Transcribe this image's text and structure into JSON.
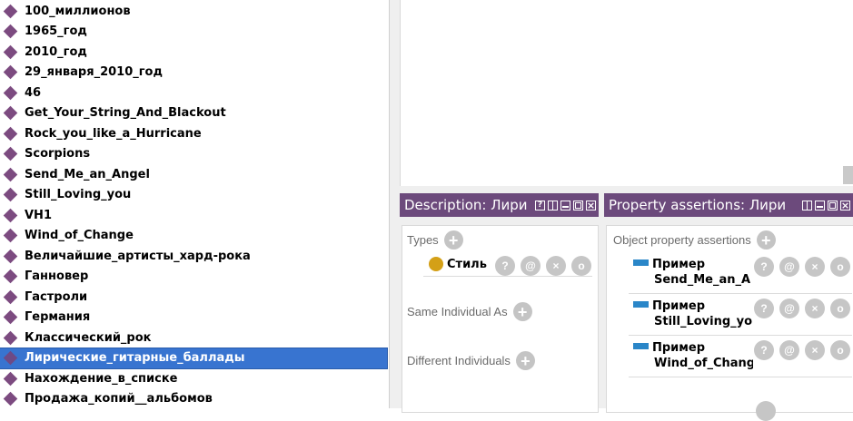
{
  "individuals": [
    "100_миллионов",
    "1965_год",
    "2010_год",
    "29_января_2010_год",
    "46",
    "Get_Your_String_And_Blackout",
    "Rock_you_like_a_Hurricane",
    "Scorpions",
    "Send_Me_an_Angel",
    "Still_Loving_you",
    "VH1",
    "Wind_of_Change",
    "Величайшие_артисты_хард-рока",
    "Ганновер",
    "Гастроли",
    "Германия",
    "Классический_рок",
    "Лирические_гитарные_баллады",
    "Нахождение_в_списке",
    "Продажа_копий__альбомов"
  ],
  "selected_individual": "Лирические_гитарные_баллады",
  "description_view": {
    "title": "Description: Лири",
    "types_label": "Types",
    "type_entry": "Стиль",
    "same_individual_label": "Same Individual As",
    "different_individuals_label": "Different Individuals"
  },
  "property_view": {
    "title": "Property assertions: Лири",
    "object_property_label": "Object property assertions",
    "assertions": [
      {
        "property": "Пример",
        "value": "Send_Me_an_A"
      },
      {
        "property": "Пример",
        "value": "Still_Loving_you"
      },
      {
        "property": "Пример",
        "value": "Wind_of_Chang"
      }
    ]
  },
  "button_glyphs": {
    "help": "?",
    "annotate": "@",
    "delete": "×",
    "edit": "o"
  },
  "colors": {
    "selection": "#3874d0",
    "titlebar": "#6c4a7c",
    "individual_icon": "#7c4b80",
    "class_icon": "#d4a017",
    "property_icon": "#2a86c8"
  }
}
